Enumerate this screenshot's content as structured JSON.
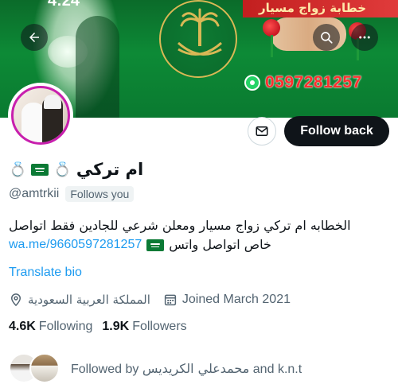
{
  "banner": {
    "status_time": "4:24",
    "ribbon_text": "خطابة زواج مسيار",
    "phone": "0597281257"
  },
  "header_actions": {
    "back_icon": "arrow-left-icon",
    "search_icon": "search-icon",
    "more_icon": "more-dots-icon"
  },
  "actions": {
    "message_icon": "envelope-icon",
    "follow_back_label": "Follow back"
  },
  "profile": {
    "display_name": "ام تركي",
    "handle": "@amtrkii",
    "follows_you": "Follows you",
    "bio_line1": "الخطابه ام تركي زواج مسيار ومعلن شرعي للجادين فقط اتواصل",
    "bio_link": "wa.me/9660597281257",
    "bio_line2_ar": "خاص اتواصل واتس",
    "translate_label": "Translate bio",
    "location": "المملكة العربية السعودية",
    "joined": "Joined March 2021"
  },
  "stats": {
    "following_count": "4.6K",
    "following_label": "Following",
    "followers_count": "1.9K",
    "followers_label": "Followers"
  },
  "followed_by": {
    "prefix": "Followed by",
    "names": "محمدعلي الكريديس",
    "conj": "and",
    "second": "k.n.t"
  }
}
